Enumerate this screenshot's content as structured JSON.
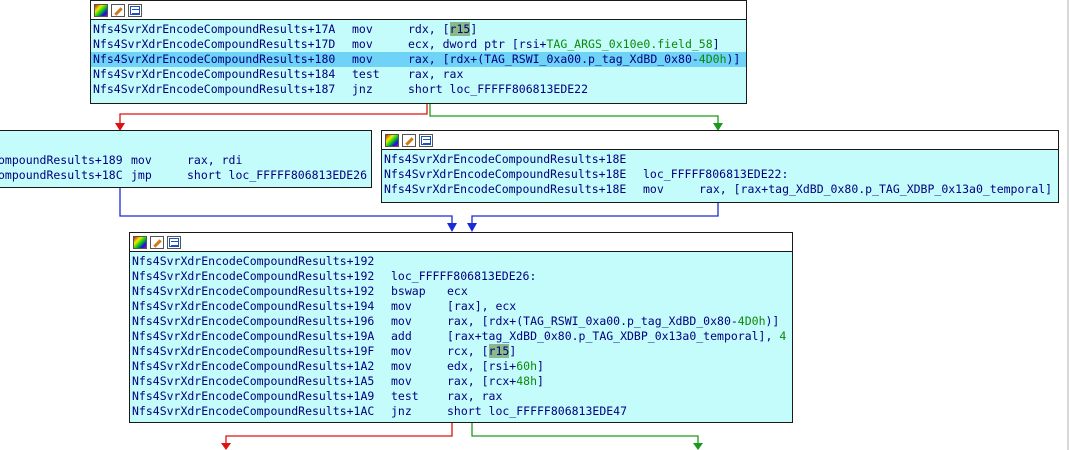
{
  "colors": {
    "block_bg": "#c4fbfb",
    "highlight_row": "#6fd2f7",
    "edge_true": "#1a9a1a",
    "edge_false": "#e01010",
    "edge_unconditional": "#1a2bd6",
    "register_highlight": "#8ab88a"
  },
  "block1": {
    "rows": [
      {
        "addr": "Nfs4SvrXdrEncodeCompoundResults+17A",
        "mnem": "mov",
        "ops_pre": "rdx, [",
        "reg": "r15",
        "ops_post": "]"
      },
      {
        "addr": "Nfs4SvrXdrEncodeCompoundResults+17D",
        "mnem": "mov",
        "ops_pre": "ecx, dword ptr [rsi+",
        "green": "TAG_ARGS_0x10e0.field_58",
        "ops_post": "]"
      },
      {
        "addr": "Nfs4SvrXdrEncodeCompoundResults+180",
        "mnem": "mov",
        "ops_pre": "rax, [rdx+(TAG_RSWI_0xa00.p_tag_XdBD_0x80-",
        "green": "4D0h",
        "ops_post": ")]"
      },
      {
        "addr": "Nfs4SvrXdrEncodeCompoundResults+184",
        "mnem": "test",
        "ops_pre": "rax, rax"
      },
      {
        "addr": "Nfs4SvrXdrEncodeCompoundResults+187",
        "mnem": "jnz",
        "ops_pre": "short loc_FFFFF806813EDE22"
      }
    ]
  },
  "block2": {
    "rows": [
      {
        "addr": "ompoundResults+189",
        "mnem": "mov",
        "ops_pre": "rax, rdi"
      },
      {
        "addr": "ompoundResults+18C",
        "mnem": "jmp",
        "ops_pre": "short loc_FFFFF806813EDE26"
      }
    ]
  },
  "block3": {
    "rows": [
      {
        "addr": "Nfs4SvrXdrEncodeCompoundResults+18E",
        "mnem": "",
        "ops_pre": ""
      },
      {
        "addr": "Nfs4SvrXdrEncodeCompoundResults+18E",
        "mnem": "loc_FFFFF806813EDE22:",
        "ops_pre": ""
      },
      {
        "addr": "Nfs4SvrXdrEncodeCompoundResults+18E",
        "mnem": "mov",
        "ops_pre": "rax, [rax+tag_XdBD_0x80.p_TAG_XDBP_0x13a0_temporal]"
      }
    ]
  },
  "block4": {
    "rows": [
      {
        "addr": "Nfs4SvrXdrEncodeCompoundResults+192",
        "mnem": "",
        "ops_pre": ""
      },
      {
        "addr": "Nfs4SvrXdrEncodeCompoundResults+192",
        "mnem": "loc_FFFFF806813EDE26:",
        "ops_pre": ""
      },
      {
        "addr": "Nfs4SvrXdrEncodeCompoundResults+192",
        "mnem": "bswap",
        "ops_pre": "ecx"
      },
      {
        "addr": "Nfs4SvrXdrEncodeCompoundResults+194",
        "mnem": "mov",
        "ops_pre": "[rax], ecx"
      },
      {
        "addr": "Nfs4SvrXdrEncodeCompoundResults+196",
        "mnem": "mov",
        "ops_pre": "rax, [rdx+(TAG_RSWI_0xa00.p_tag_XdBD_0x80-",
        "green": "4D0h",
        "ops_post": ")]"
      },
      {
        "addr": "Nfs4SvrXdrEncodeCompoundResults+19A",
        "mnem": "add",
        "ops_pre": "[rax+tag_XdBD_0x80.p_TAG_XDBP_0x13a0_temporal], ",
        "green": "4"
      },
      {
        "addr": "Nfs4SvrXdrEncodeCompoundResults+19F",
        "mnem": "mov",
        "ops_pre": "rcx, [",
        "reg": "r15",
        "ops_post": "]"
      },
      {
        "addr": "Nfs4SvrXdrEncodeCompoundResults+1A2",
        "mnem": "mov",
        "ops_pre": "edx, [rsi+",
        "green": "60h",
        "ops_post": "]"
      },
      {
        "addr": "Nfs4SvrXdrEncodeCompoundResults+1A5",
        "mnem": "mov",
        "ops_pre": "rax, [rcx+",
        "green": "48h",
        "ops_post": "]"
      },
      {
        "addr": "Nfs4SvrXdrEncodeCompoundResults+1A9",
        "mnem": "test",
        "ops_pre": "rax, rax"
      },
      {
        "addr": "Nfs4SvrXdrEncodeCompoundResults+1AC",
        "mnem": "jnz",
        "ops_pre": "short loc_FFFFF806813EDE47"
      }
    ]
  }
}
